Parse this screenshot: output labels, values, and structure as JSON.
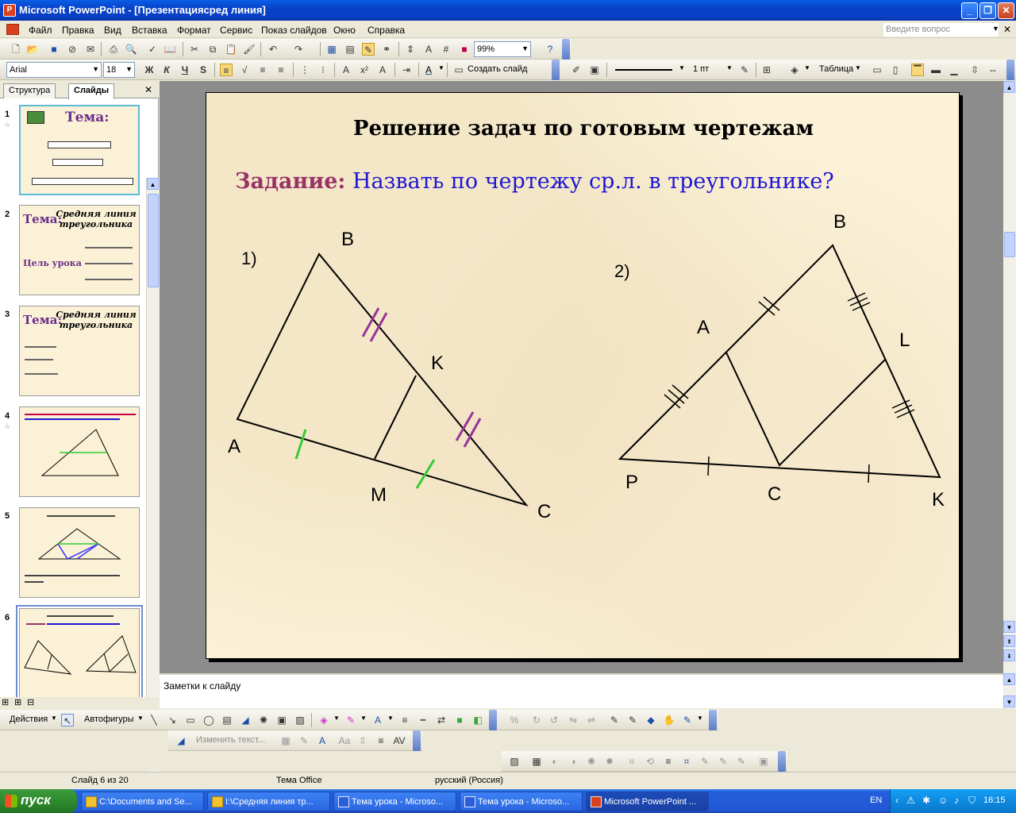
{
  "window": {
    "title": "Microsoft PowerPoint - [Презентациясред линия]"
  },
  "menu": {
    "items": [
      "Файл",
      "Правка",
      "Вид",
      "Вставка",
      "Формат",
      "Сервис",
      "Показ слайдов",
      "Окно",
      "Справка"
    ],
    "ask_placeholder": "Введите вопрос"
  },
  "toolbar_standard": {
    "zoom": "99%"
  },
  "toolbar_format": {
    "font": "Arial",
    "size": "18",
    "bold": "Ж",
    "italic": "К",
    "underline": "Ч",
    "shadow": "S",
    "new_slide": "Создать слайд",
    "line_weight": "1 пт",
    "table": "Таблица"
  },
  "left_panel": {
    "tabs": [
      "Структура",
      "Слайды"
    ],
    "active_tab": "Слайды",
    "thumbnails": [
      {
        "num": "1",
        "title": "Тема:"
      },
      {
        "num": "2",
        "title": "Тема:",
        "subtitle": "Средняя линия треугольника",
        "extra": "Цель урока"
      },
      {
        "num": "3",
        "title": "Тема:",
        "subtitle": "Средняя линия треугольника"
      },
      {
        "num": "4"
      },
      {
        "num": "5"
      },
      {
        "num": "6"
      }
    ]
  },
  "slide": {
    "title": "Решение задач по готовым чертежам",
    "task_label": "Задание:",
    "task_text": "Назвать по чертежу ср.л. в треугольнике?",
    "fig1": {
      "label": "1)",
      "A": "A",
      "B": "B",
      "C": "C",
      "K": "K",
      "M": "M"
    },
    "fig2": {
      "label": "2)",
      "A": "A",
      "B": "B",
      "L": "L",
      "P": "P",
      "C": "C",
      "K": "K"
    }
  },
  "notes": {
    "placeholder": "Заметки к слайду"
  },
  "draw_toolbar": {
    "actions": "Действия",
    "autoshapes": "Автофигуры",
    "edit_text": "Изменить текст..."
  },
  "status": {
    "slide": "Слайд 6 из 20",
    "theme": "Тема Office",
    "language": "русский (Россия)"
  },
  "taskbar": {
    "start": "пуск",
    "buttons": [
      "C:\\Documents and Se...",
      "I:\\Средняя линия тр...",
      "Тема урока - Microso...",
      "Тема урока - Microso...",
      "Microsoft PowerPoint ..."
    ],
    "lang": "EN",
    "clock": "16:15"
  },
  "colors": {
    "title_bar": "#0842c9",
    "task_label": "#993366",
    "task_text": "#1f16d4",
    "tick_green": "#33cc00",
    "tick_purple": "#993399",
    "slide_bg": "#fbf2d8"
  }
}
